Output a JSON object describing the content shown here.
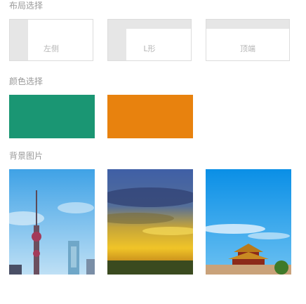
{
  "layout_section": {
    "title": "布局选择",
    "options": [
      {
        "label": "左侧"
      },
      {
        "label": "L形"
      },
      {
        "label": "顶端"
      }
    ]
  },
  "color_section": {
    "title": "颜色选择",
    "colors": [
      "#1a9673",
      "#e8820e"
    ]
  },
  "background_section": {
    "title": "背景图片",
    "images": [
      {
        "name": "city-tower-image"
      },
      {
        "name": "sunset-clouds-image"
      },
      {
        "name": "palace-roof-image"
      }
    ]
  }
}
